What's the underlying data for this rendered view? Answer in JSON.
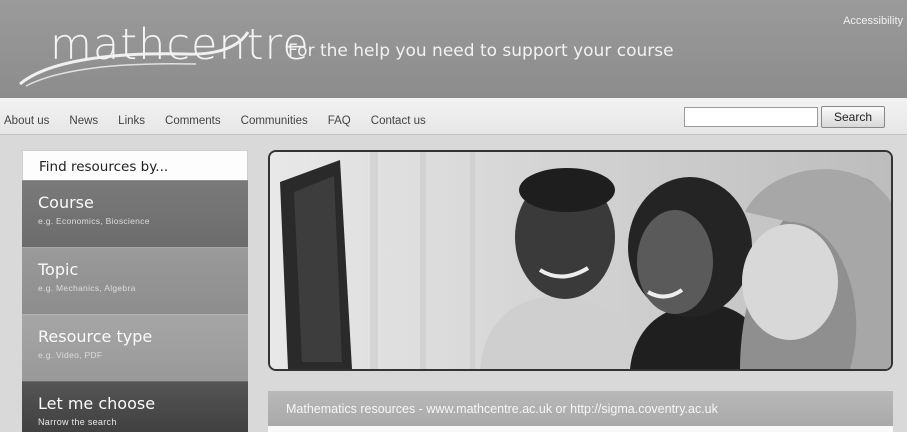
{
  "header": {
    "logo_text": "mathcentre",
    "tagline": "For the help you need to support your course",
    "accessibility_label": "Accessibility"
  },
  "nav": {
    "items": [
      {
        "label": "About us"
      },
      {
        "label": "News"
      },
      {
        "label": "Links"
      },
      {
        "label": "Comments"
      },
      {
        "label": "Communities"
      },
      {
        "label": "FAQ"
      },
      {
        "label": "Contact us"
      }
    ]
  },
  "search": {
    "value": "",
    "button_label": "Search"
  },
  "finder": {
    "title": "Find resources by...",
    "items": [
      {
        "title": "Course",
        "subtitle": "e.g. Economics, Bioscience"
      },
      {
        "title": "Topic",
        "subtitle": "e.g. Mechanics, Algebra"
      },
      {
        "title": "Resource type",
        "subtitle": "e.g. Video, PDF"
      },
      {
        "title": "Let me choose",
        "subtitle": "Narrow the search"
      }
    ]
  },
  "resources_bar": {
    "text": "Mathematics resources - www.mathcentre.ac.uk or http://sigma.coventry.ac.uk"
  },
  "colors": {
    "header_bg": "#8c8c8c",
    "nav_bg": "#eeeeee",
    "page_bg": "#d9d9d9"
  }
}
